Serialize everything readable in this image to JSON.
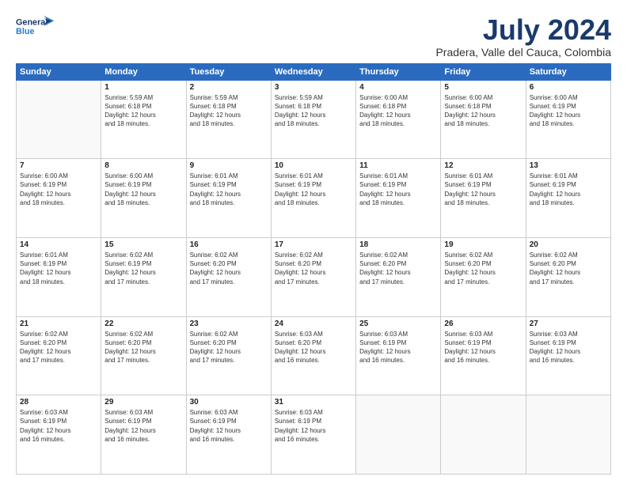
{
  "header": {
    "logo_line1": "General",
    "logo_line2": "Blue",
    "month_year": "July 2024",
    "location": "Pradera, Valle del Cauca, Colombia"
  },
  "weekdays": [
    "Sunday",
    "Monday",
    "Tuesday",
    "Wednesday",
    "Thursday",
    "Friday",
    "Saturday"
  ],
  "weeks": [
    [
      {
        "num": "",
        "info": ""
      },
      {
        "num": "1",
        "info": "Sunrise: 5:59 AM\nSunset: 6:18 PM\nDaylight: 12 hours\nand 18 minutes."
      },
      {
        "num": "2",
        "info": "Sunrise: 5:59 AM\nSunset: 6:18 PM\nDaylight: 12 hours\nand 18 minutes."
      },
      {
        "num": "3",
        "info": "Sunrise: 5:59 AM\nSunset: 6:18 PM\nDaylight: 12 hours\nand 18 minutes."
      },
      {
        "num": "4",
        "info": "Sunrise: 6:00 AM\nSunset: 6:18 PM\nDaylight: 12 hours\nand 18 minutes."
      },
      {
        "num": "5",
        "info": "Sunrise: 6:00 AM\nSunset: 6:18 PM\nDaylight: 12 hours\nand 18 minutes."
      },
      {
        "num": "6",
        "info": "Sunrise: 6:00 AM\nSunset: 6:19 PM\nDaylight: 12 hours\nand 18 minutes."
      }
    ],
    [
      {
        "num": "7",
        "info": "Sunrise: 6:00 AM\nSunset: 6:19 PM\nDaylight: 12 hours\nand 18 minutes."
      },
      {
        "num": "8",
        "info": "Sunrise: 6:00 AM\nSunset: 6:19 PM\nDaylight: 12 hours\nand 18 minutes."
      },
      {
        "num": "9",
        "info": "Sunrise: 6:01 AM\nSunset: 6:19 PM\nDaylight: 12 hours\nand 18 minutes."
      },
      {
        "num": "10",
        "info": "Sunrise: 6:01 AM\nSunset: 6:19 PM\nDaylight: 12 hours\nand 18 minutes."
      },
      {
        "num": "11",
        "info": "Sunrise: 6:01 AM\nSunset: 6:19 PM\nDaylight: 12 hours\nand 18 minutes."
      },
      {
        "num": "12",
        "info": "Sunrise: 6:01 AM\nSunset: 6:19 PM\nDaylight: 12 hours\nand 18 minutes."
      },
      {
        "num": "13",
        "info": "Sunrise: 6:01 AM\nSunset: 6:19 PM\nDaylight: 12 hours\nand 18 minutes."
      }
    ],
    [
      {
        "num": "14",
        "info": "Sunrise: 6:01 AM\nSunset: 6:19 PM\nDaylight: 12 hours\nand 18 minutes."
      },
      {
        "num": "15",
        "info": "Sunrise: 6:02 AM\nSunset: 6:19 PM\nDaylight: 12 hours\nand 17 minutes."
      },
      {
        "num": "16",
        "info": "Sunrise: 6:02 AM\nSunset: 6:20 PM\nDaylight: 12 hours\nand 17 minutes."
      },
      {
        "num": "17",
        "info": "Sunrise: 6:02 AM\nSunset: 6:20 PM\nDaylight: 12 hours\nand 17 minutes."
      },
      {
        "num": "18",
        "info": "Sunrise: 6:02 AM\nSunset: 6:20 PM\nDaylight: 12 hours\nand 17 minutes."
      },
      {
        "num": "19",
        "info": "Sunrise: 6:02 AM\nSunset: 6:20 PM\nDaylight: 12 hours\nand 17 minutes."
      },
      {
        "num": "20",
        "info": "Sunrise: 6:02 AM\nSunset: 6:20 PM\nDaylight: 12 hours\nand 17 minutes."
      }
    ],
    [
      {
        "num": "21",
        "info": "Sunrise: 6:02 AM\nSunset: 6:20 PM\nDaylight: 12 hours\nand 17 minutes."
      },
      {
        "num": "22",
        "info": "Sunrise: 6:02 AM\nSunset: 6:20 PM\nDaylight: 12 hours\nand 17 minutes."
      },
      {
        "num": "23",
        "info": "Sunrise: 6:02 AM\nSunset: 6:20 PM\nDaylight: 12 hours\nand 17 minutes."
      },
      {
        "num": "24",
        "info": "Sunrise: 6:03 AM\nSunset: 6:20 PM\nDaylight: 12 hours\nand 16 minutes."
      },
      {
        "num": "25",
        "info": "Sunrise: 6:03 AM\nSunset: 6:19 PM\nDaylight: 12 hours\nand 16 minutes."
      },
      {
        "num": "26",
        "info": "Sunrise: 6:03 AM\nSunset: 6:19 PM\nDaylight: 12 hours\nand 16 minutes."
      },
      {
        "num": "27",
        "info": "Sunrise: 6:03 AM\nSunset: 6:19 PM\nDaylight: 12 hours\nand 16 minutes."
      }
    ],
    [
      {
        "num": "28",
        "info": "Sunrise: 6:03 AM\nSunset: 6:19 PM\nDaylight: 12 hours\nand 16 minutes."
      },
      {
        "num": "29",
        "info": "Sunrise: 6:03 AM\nSunset: 6:19 PM\nDaylight: 12 hours\nand 16 minutes."
      },
      {
        "num": "30",
        "info": "Sunrise: 6:03 AM\nSunset: 6:19 PM\nDaylight: 12 hours\nand 16 minutes."
      },
      {
        "num": "31",
        "info": "Sunrise: 6:03 AM\nSunset: 6:19 PM\nDaylight: 12 hours\nand 16 minutes."
      },
      {
        "num": "",
        "info": ""
      },
      {
        "num": "",
        "info": ""
      },
      {
        "num": "",
        "info": ""
      }
    ]
  ]
}
